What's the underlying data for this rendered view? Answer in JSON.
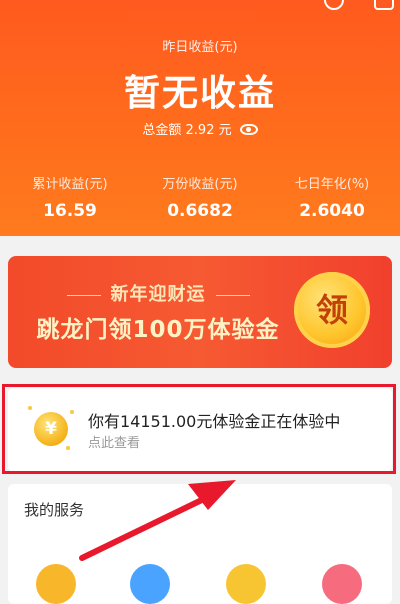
{
  "header": {
    "yesterday_label": "昨日收益(元)",
    "yesterday_value": "暂无收益",
    "total_label": "总金额 2.92 元",
    "stats": [
      {
        "label": "累计收益(元)",
        "value": "16.59"
      },
      {
        "label": "万份收益(元)",
        "value": "0.6682"
      },
      {
        "label": "七日年化(%)",
        "value": "2.6040"
      }
    ]
  },
  "promo": {
    "line1": "新年迎财运",
    "line2": "跳龙门领100万体验金",
    "button": "领"
  },
  "experience": {
    "coin_symbol": "¥",
    "text": "你有14151.00元体验金正在体验中",
    "sub": "点此查看"
  },
  "services": {
    "title": "我的服务"
  },
  "colors": {
    "header": "#ff5a1f",
    "highlight_frame": "#e8192c"
  }
}
